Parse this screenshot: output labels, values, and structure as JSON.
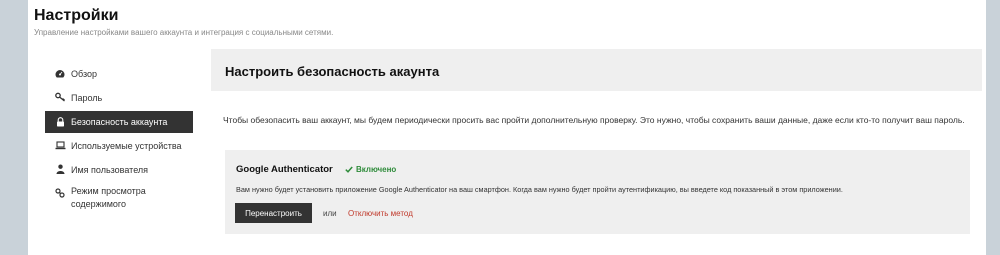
{
  "header": {
    "title": "Настройки",
    "subtitle": "Управление настройками вашего аккаунта и интеграция с социальными сетями."
  },
  "sidebar": {
    "items": [
      {
        "label": "Обзор",
        "icon": "dashboard-icon"
      },
      {
        "label": "Пароль",
        "icon": "key-icon"
      },
      {
        "label": "Безопасность аккаунта",
        "icon": "lock-icon",
        "active": true
      },
      {
        "label": "Используемые устройства",
        "icon": "laptop-icon"
      },
      {
        "label": "Имя пользователя",
        "icon": "user-icon"
      },
      {
        "label": "Режим просмотра содержимого",
        "icon": "link-icon"
      }
    ]
  },
  "main": {
    "heading": "Настроить безопасность акаунта",
    "intro": "Чтобы обезопасить ваш аккаунт, мы будем периодически просить вас пройти дополнительную проверку. Это нужно, чтобы сохранить ваши данные, даже если кто-то получит ваш пароль.",
    "authenticator": {
      "title": "Google Authenticator",
      "status": "Включено",
      "description": "Вам нужно будет установить приложение Google Authenticator на ваш смартфон. Когда вам нужно будет пройти аутентификацию, вы введете код показанный в этом приложении.",
      "reconfigure_label": "Перенастроить",
      "or_label": "или",
      "disable_label": "Отключить метод"
    }
  },
  "colors": {
    "active_bg": "#333333",
    "status_green": "#2e8b3a",
    "danger_link": "#c0392b"
  }
}
